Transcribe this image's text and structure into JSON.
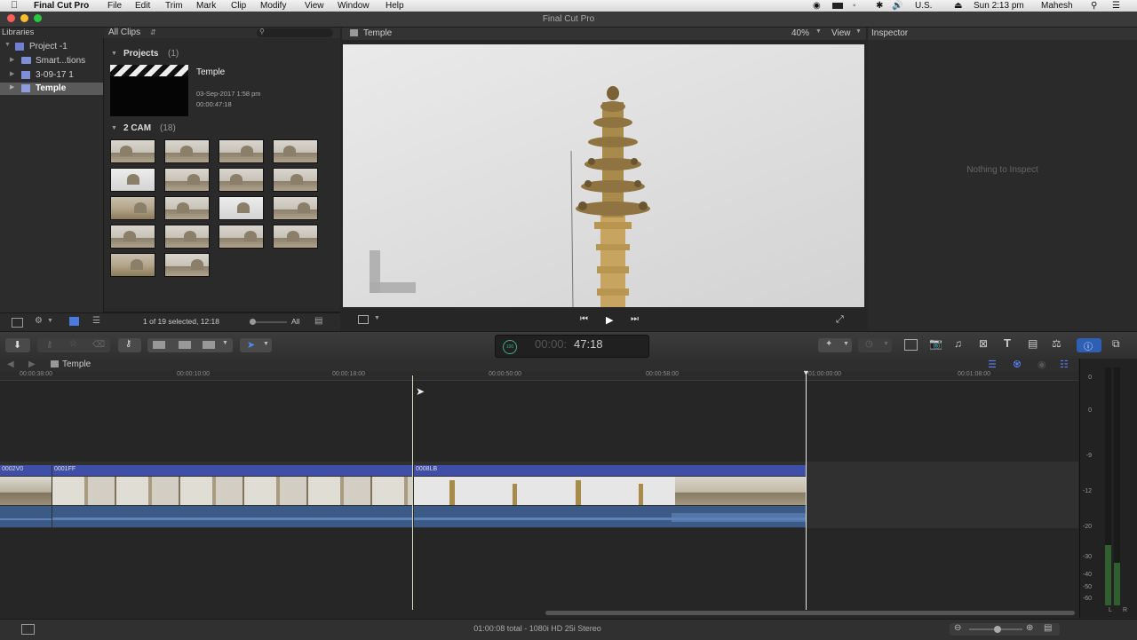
{
  "menubar": {
    "apple": "",
    "app": "Final Cut Pro",
    "items": [
      "File",
      "Edit",
      "Trim",
      "Mark",
      "Clip",
      "Modify",
      "View",
      "Window",
      "Help"
    ],
    "status": {
      "lang": "U.S.",
      "clock": "Sun 2:13 pm",
      "user": "Mahesh"
    }
  },
  "window_title": "Final Cut Pro",
  "libraries": {
    "header": "Libraries",
    "items": [
      {
        "label": "Project -1"
      },
      {
        "label": "Smart...tions"
      },
      {
        "label": "3-09-17 1"
      },
      {
        "label": "Temple"
      }
    ]
  },
  "browser": {
    "filter": "All Clips",
    "projects_header": "Projects",
    "projects_count": "(1)",
    "project": {
      "name": "Temple",
      "date": "03-Sep-2017 1:58 pm",
      "duration": "00:00:47:18"
    },
    "event_header": "2 CAM",
    "event_count": "(18)",
    "footer_status": "1 of 19 selected, 12:18",
    "footer_all": "All"
  },
  "viewer": {
    "title": "Temple",
    "zoom": "40%",
    "view_menu": "View",
    "watermark": "L"
  },
  "inspector": {
    "header": "Inspector",
    "empty": "Nothing to Inspect"
  },
  "toolbar": {
    "timecode": "47:18",
    "timecode_dim": "00:00:",
    "timecode_small": "100"
  },
  "timeline": {
    "project_name": "Temple",
    "ruler": [
      "00:00:38:00",
      "00:00:10:00",
      "00:00:18:00",
      "00:00:50:00",
      "00:00:58:00",
      "01:00:00:00",
      "00:01:08:00"
    ],
    "clips": [
      "0002V0",
      "0001FF",
      "0008LB"
    ],
    "footer": "01:00:08 total - 1080i HD 25i Stereo"
  },
  "meters": {
    "labels": [
      "0",
      "0",
      "-9",
      "-12",
      "-20",
      "-30",
      "-40",
      "-50",
      "-60"
    ],
    "channels": [
      "L",
      "R"
    ]
  }
}
